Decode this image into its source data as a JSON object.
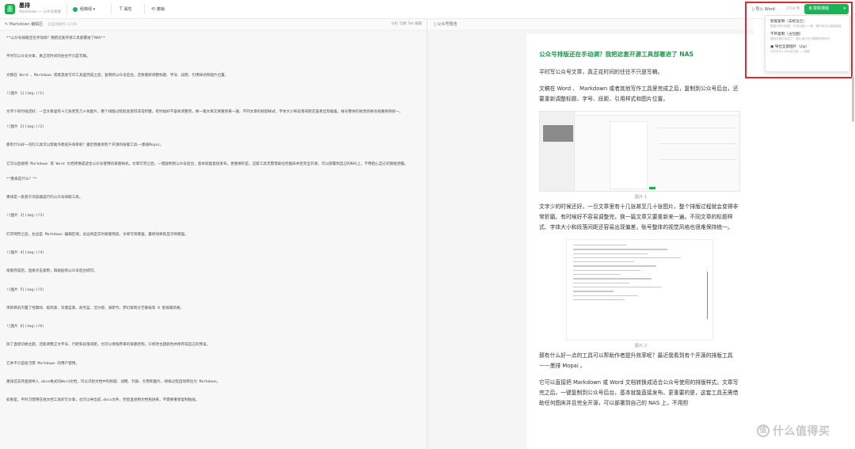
{
  "app": {
    "logo_char": "墨",
    "name": "墨排",
    "subtitle": "Markdown 一 公众号排版"
  },
  "toolbar": {
    "theme_label": "经典绿",
    "theme_chevron": "▾",
    "settings_label": "属性",
    "settings_icon": "T",
    "reset_label": "撤销",
    "reset_icon": "⟲",
    "import_label": "导入 Word",
    "char_count": "1714 字",
    "copy_label": "复制排版",
    "copy_chevron": "▾"
  },
  "editor_bar": {
    "title": "Markdown 编辑区",
    "meta": "已自动保存 12:56",
    "opts": "分栏   切换 Tab 编辑"
  },
  "preview_bar": {
    "title": "公众号预览"
  },
  "editor_lines": [
    "**公众号排版还在手动调？我把这套开源工具部署进了NAS**",
    "平时写公众号文章，真正花时间的往往不只是写稿。",
    "文稿在 Word 、Markdown 或者其他写作工具里完成之后，复制到公众号后台，还要重新调整标题、字号、段距、引用样式和图片位置。",
    "![图片 1](img://1)",
    "文字少的时候还好，一旦文章里有十几张甚至几十张图片，整个排版过程就会变得非常折磨。有时候好不容易调整完，换一篇文章又要重新来一遍。不同文章的标题样式、字体大小和段落间距还容易出现偏差，账号整体的视觉风格也很难保持统一。",
    "![图片 2](img://2)",
    "那有什么好一点的工具可以帮助作者提升效率呢？最近我看到有个开源的排版工具——墨排Mopai。",
    "它可以直接把 Markdown 或 Word 文档转换成适合公众号使用的排版样式。文章写完之后，一键复制到公众号后台，基本就能直接发布。更重要的是，这套工具无需借助任何图床并且完全开源，可以部署到自己的NAS上，不用担心自己的数据泄露。",
    "**墨排是什么？**",
    "墨排是一套基于浏览器运行的公众号排版工具。",
    "![图片 3](img://3)",
    "打开网页之后，左边是 Markdown 编辑区域，右边则是实时排版预览，文章写到哪里，最终效果就显示到哪里。",
    "![图片 4](img://4)",
    "排版完成后，直接点击复制，再粘贴到公众号后台即可。",
    "![图片 5](img://5)",
    "项目目前内置了经典绿、极简黑、深邃蓝紫、商务蓝、活力橙、清新竹、梦幻紫和文艺静谧等 8 套排版风格。",
    "![图片 6](img://6)",
    "除了直接切换主题，还能调整正文字号、行距和段落间距，也可以保留原来的排版结构，只修改主题颜色并保存成自己的预设。",
    "它并不只是给习惯 Markdown 的用户使用。",
    "墨排还支持直接导入.docx格式的Word文档，可以识别文档中的标题、加粗、列表、引用和图片，将排过程自动转化为 Markdown。",
    "如果是，平时习惯用在线文档工具的写文章，也可以导出成.docx文件，然后直接把文档拖进来，不需要重新复制粘贴。"
  ],
  "preview": {
    "title": "公众号排版还在手动调？我把这套开源工具部署进了 NAS",
    "p1": "平时写公众号文章，真正花时间的往往不只是写稿。",
    "p2": "文稿在 Word 、 Markdown 或者其他写作工具里完成之后，复制到公众号后台，还要重新调整标题、字号、段距、引用样式和图片位置。",
    "cap1": "图片 1",
    "p3": "文字少的时候还好，一旦文章里有十几张甚至几十张图片，整个排版过程就会变得非常折磨。有时候好不容易调整完，换一篇文章又要重新来一遍。不同文章的标题样式、字体大小和段落间距还容易出现偏差，账号整体的视觉风格也很难保持统一。",
    "cap2": "图片 2",
    "p4": "那有什么好一点的工具可以帮助作者提升效率呢？最近我看到有个开源的排版工具——墨排 Mopai 。",
    "p5": "它可以直接把 Markdown 或 Word 文档转换成适合公众号使用的排版样式。文章写完之后，一键复制到公众号后台，基本就能直接发布。更重要的是，这套工具无需借助任何图床并且完全开源，可以部署到自己的 NAS 上，不用担"
  },
  "copy_menu": [
    {
      "title": "智能复制（去标注兰）",
      "desc": "智能识别对话框，并自动嵌入一般，偶尔就可以直接粘贴"
    },
    {
      "title": "不带复制（占位图）",
      "desc": "复制无图片标注了，图片用占位代替原来的样式"
    },
    {
      "title": "导出全部图片（zip）",
      "desc": "文件存为1.info包文档——加粗"
    }
  ],
  "watermark": {
    "icon": "值",
    "text": "什么值得买"
  },
  "colors": {
    "brand_green": "#18b455",
    "title_green": "#14a04a",
    "highlight_red": "#e32a2a"
  }
}
